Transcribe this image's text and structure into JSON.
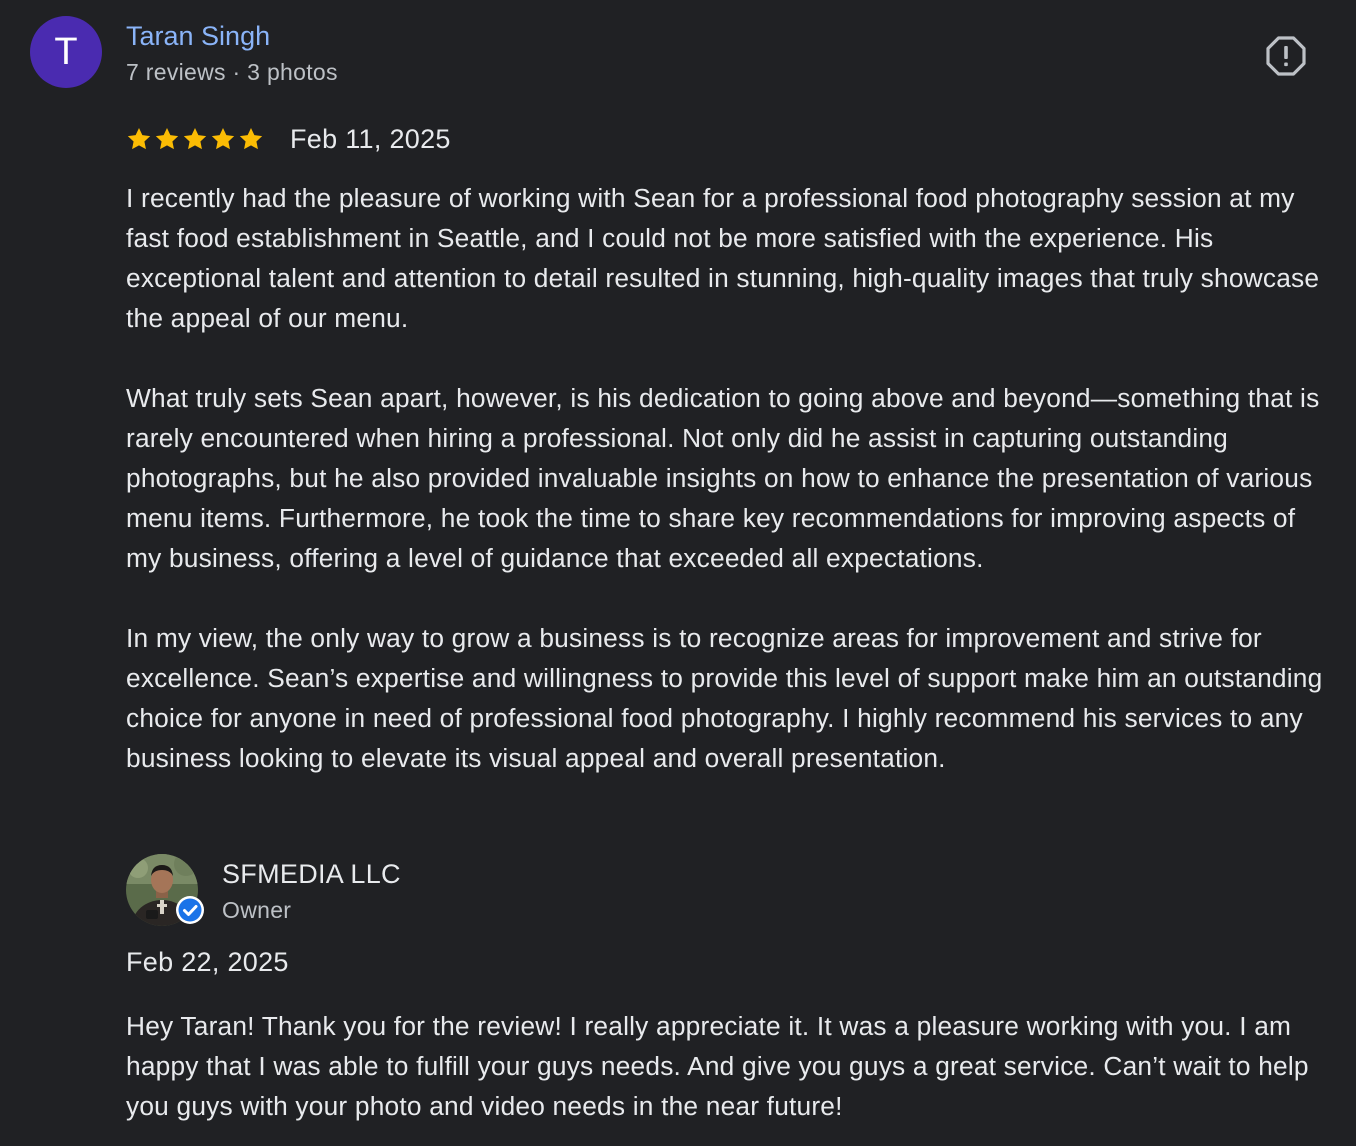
{
  "review": {
    "reviewer": {
      "initial": "T",
      "name": "Taran Singh",
      "meta": "7 reviews · 3 photos",
      "avatar_color": "#4a2bb0"
    },
    "rating": 5,
    "rating_max": 5,
    "date": "Feb 11, 2025",
    "paragraphs": [
      "I recently had the pleasure of working with Sean for a professional food photography session at my fast food establishment in Seattle, and I could not be more satisfied with the experience. His exceptional talent and attention to detail resulted in stunning, high-quality images that truly showcase the appeal of our menu.",
      "What truly sets Sean apart, however, is his dedication to going above and beyond—something that is rarely encountered when hiring a professional. Not only did he assist in capturing outstanding photographs, but he also provided invaluable insights on how to enhance the presentation of various menu items. Furthermore, he took the time to share key recommendations for improving aspects of my business, offering a level of guidance that exceeded all expectations.",
      "In my view, the only way to grow a business is to recognize areas for improvement and strive for excellence. Sean’s expertise and willingness to provide this level of support make him an outstanding choice for anyone in need of professional food photography. I highly recommend his services to any business looking to elevate its visual appeal and overall presentation."
    ],
    "flag_icon": "report-flag-icon"
  },
  "owner_reply": {
    "name": "SFMEDIA LLC",
    "role": "Owner",
    "date": "Feb 22, 2025",
    "text": "Hey Taran! Thank you for the review! I really appreciate it. It was a pleasure working with you. I am happy that I was able to fulfill your guys needs. And give you guys a great service. Can’t wait to help you guys with your photo and video needs in the near future!",
    "verified_icon": "verified-badge-icon"
  },
  "colors": {
    "background": "#202124",
    "name_link": "#8ab4f8",
    "star": "#fbbc04",
    "secondary_text": "#bdc1c6",
    "verified_badge": "#1a73e8"
  }
}
